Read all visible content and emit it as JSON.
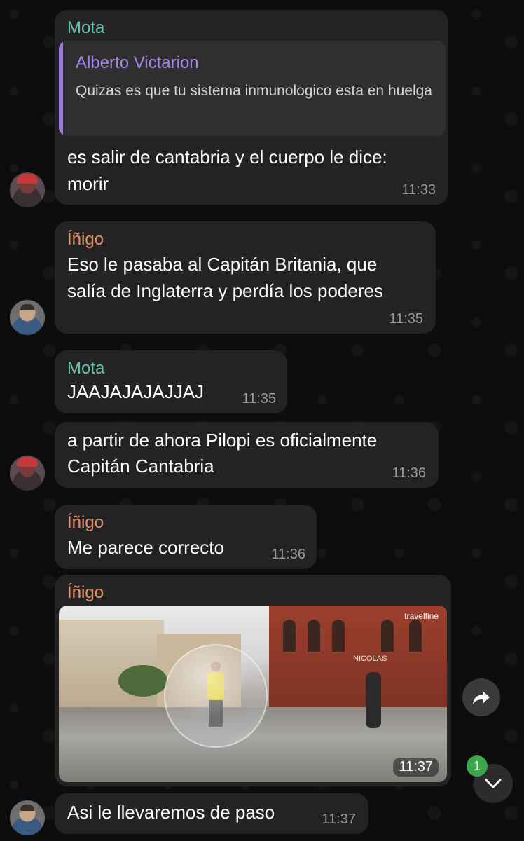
{
  "messages": [
    {
      "sender": "Mota",
      "quote": {
        "name": "Alberto Victarion",
        "text": "Quizas es que tu sistema inmunologico esta en huelga"
      },
      "lines": [
        "es salir de cantabria y el cuerpo le dice:",
        "morir"
      ],
      "time": "11:33"
    },
    {
      "sender": "Íñigo",
      "lines": [
        "Eso le pasaba al Capitán Britania, que",
        "salía de Inglaterra y perdía los poderes"
      ],
      "time": "11:35"
    },
    {
      "sender": "Mota",
      "lines": [
        "JAAJAJAJAJJAJ"
      ],
      "time": "11:35"
    },
    {
      "lines": [
        "a partir de ahora Pilopi es oficialmente",
        "Capitán Cantabria"
      ],
      "time": "11:36"
    },
    {
      "sender": "Íñigo",
      "lines": [
        "Me parece correcto"
      ],
      "time": "11:36"
    },
    {
      "sender": "Íñigo",
      "video": {
        "time": "11:37",
        "watermark": "travelfine",
        "sign": "NICOLAS"
      },
      "time": "11:37"
    },
    {
      "lines": [
        "Asi le llevaremos de paso"
      ],
      "time": "11:37"
    }
  ],
  "unread_badge": "1",
  "icons": {
    "forward": "forward-arrow-icon",
    "scroll_down": "chevron-down-icon"
  },
  "colors": {
    "background": "#0d0d0d",
    "bubble": "#232323",
    "sender_mota": "#66c3b0",
    "sender_inigo": "#e4926a",
    "quote_accent": "#9b7ad9",
    "badge": "#3aa74a"
  }
}
